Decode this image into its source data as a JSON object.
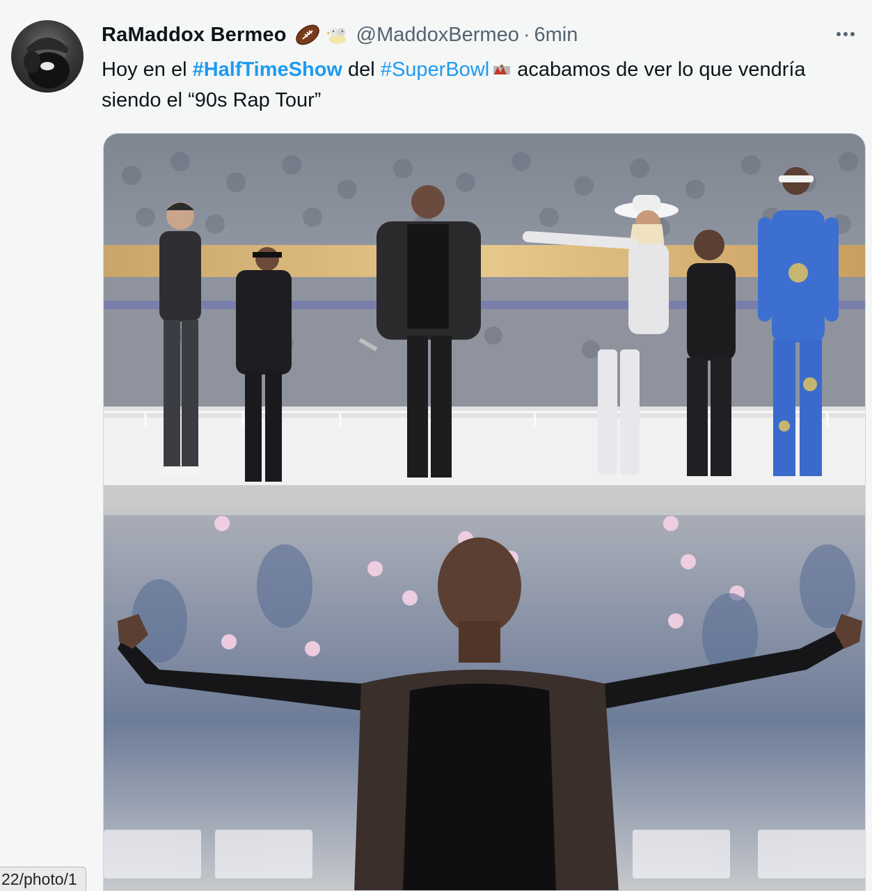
{
  "tweet": {
    "author": {
      "display_name": "RaMaddox Bermeo",
      "emojis": [
        "american-football-icon",
        "rubber-duck-icon"
      ],
      "handle": "@MaddoxBermeo",
      "separator": "·",
      "time": "6min"
    },
    "text": {
      "part1": "Hoy en el ",
      "hashtag1": "#HalfTimeShow",
      "part2": " del ",
      "hashtag2": "#SuperBowl",
      "part3": " acabamos de ver lo que vendría siendo el “90s Rap Tour”"
    },
    "media": [
      {
        "description_icon": "stage-performers-photo"
      },
      {
        "description_icon": "performer-arms-wide-photo"
      }
    ]
  },
  "status_bar": {
    "url": "22/photo/1"
  },
  "colors": {
    "link": "#1d9bf0",
    "secondary_text": "#536471",
    "primary_text": "#0f1419"
  }
}
